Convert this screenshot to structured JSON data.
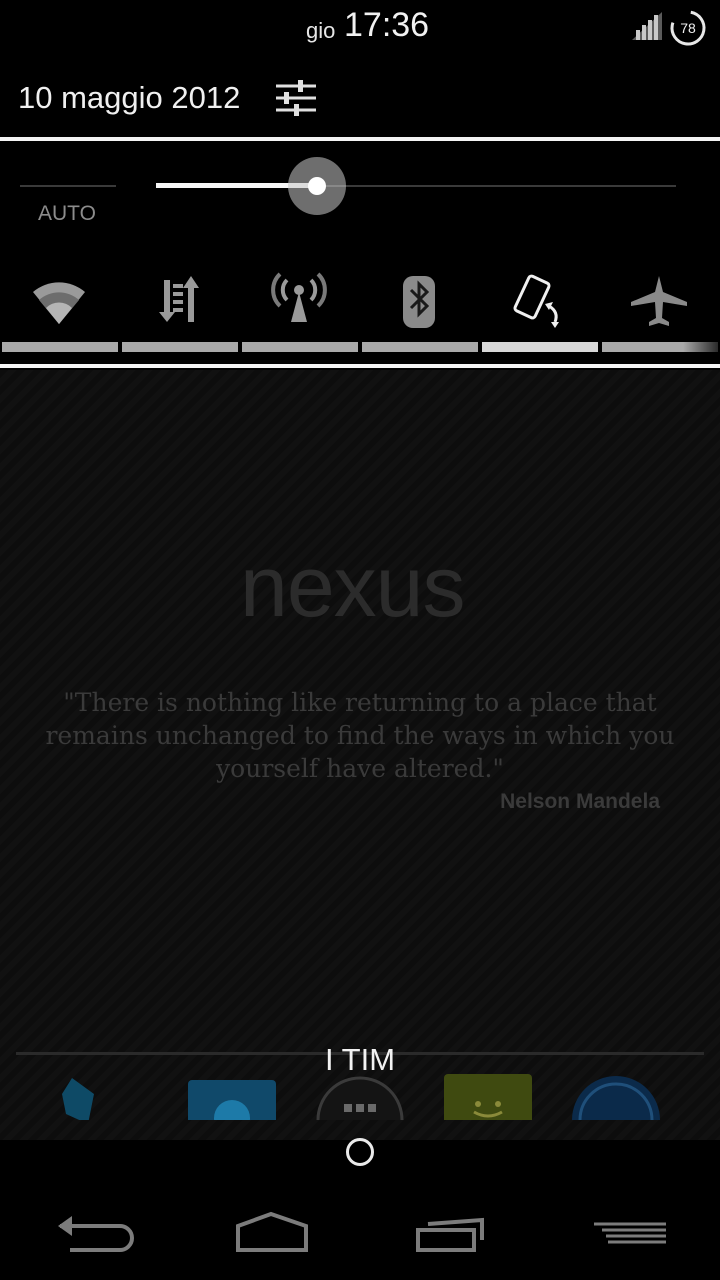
{
  "status_bar": {
    "day": "gio",
    "time": "17:36",
    "battery_level": "78"
  },
  "header": {
    "date": "10 maggio 2012"
  },
  "brightness": {
    "auto_label": "AUTO",
    "level": 0.31
  },
  "toggles": [
    "wifi",
    "mobile-data",
    "hotspot",
    "bluetooth",
    "auto-rotate",
    "airplane-mode"
  ],
  "wallpaper": {
    "brand": "nexus",
    "quote": "\"There is nothing like returning to a place that remains unchanged to find the ways in which you yourself have altered.\"",
    "author": "Nelson Mandela"
  },
  "dock": {
    "carrier": "I TIM"
  },
  "colors": {
    "background": "#000000",
    "accent": "#f4f4f4"
  }
}
